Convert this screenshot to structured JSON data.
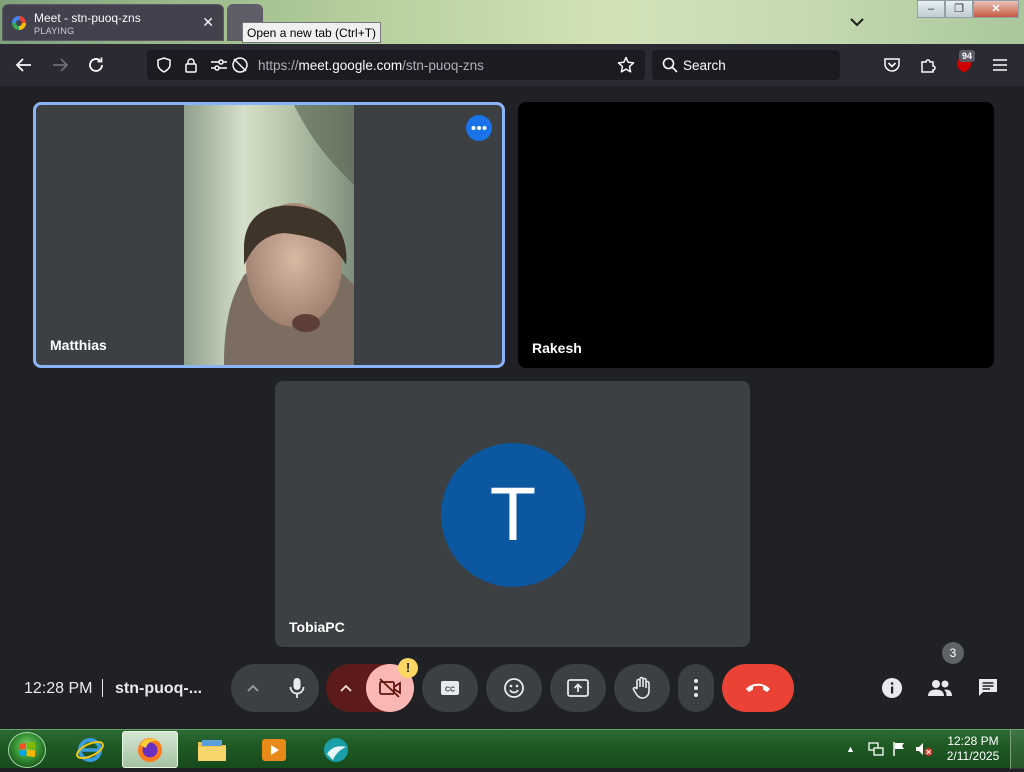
{
  "browser": {
    "tab": {
      "title": "Meet - stn-puoq-zns",
      "status": "PLAYING"
    },
    "tooltip": "Open a new tab (Ctrl+T)",
    "url": {
      "scheme": "https://",
      "host": "meet.google.com",
      "path": "/stn-puoq-zns"
    },
    "search_placeholder": "Search",
    "extension_badge": "94"
  },
  "meet": {
    "participants": [
      {
        "name": "Matthias",
        "video": "on"
      },
      {
        "name": "Rakesh",
        "video": "off"
      },
      {
        "name": "TobiaPC",
        "avatar_letter": "T",
        "avatar_color": "#0b57a0"
      }
    ],
    "time": "12:28 PM",
    "meeting_code": "stn-puoq-...",
    "warning_badge": "!",
    "people_count": "3",
    "colors": {
      "accent": "#8ab4f8",
      "end_call": "#ea4335",
      "camera_off_bg": "#f9b8b4"
    }
  },
  "taskbar": {
    "clock_time": "12:28 PM",
    "clock_date": "2/11/2025"
  }
}
